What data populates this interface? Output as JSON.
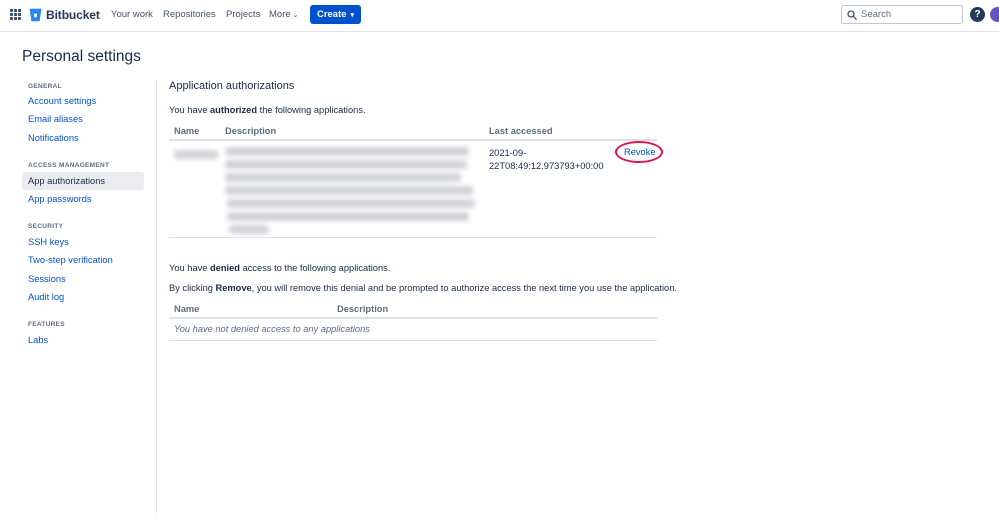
{
  "nav": {
    "product": "Bitbucket",
    "links": [
      "Your work",
      "Repositories",
      "Projects",
      "More"
    ],
    "create_label": "Create",
    "search_placeholder": "Search",
    "help_label": "?"
  },
  "page": {
    "title": "Personal settings"
  },
  "sidebar": {
    "sections": [
      {
        "heading": "GENERAL",
        "items": [
          "Account settings",
          "Email aliases",
          "Notifications"
        ]
      },
      {
        "heading": "ACCESS MANAGEMENT",
        "items": [
          "App authorizations",
          "App passwords"
        ]
      },
      {
        "heading": "SECURITY",
        "items": [
          "SSH keys",
          "Two-step verification",
          "Sessions",
          "Audit log"
        ]
      },
      {
        "heading": "FEATURES",
        "items": [
          "Labs"
        ]
      }
    ],
    "active_item": "App authorizations"
  },
  "authorized": {
    "heading": "Application authorizations",
    "intro_pre": "You have ",
    "intro_bold": "authorized",
    "intro_post": " the following applications.",
    "columns": [
      "Name",
      "Description",
      "Last accessed"
    ],
    "rows": [
      {
        "last_accessed_line1": "2021-09-",
        "last_accessed_line2": "22T08:49:12.973793+00:00",
        "action": "Revoke"
      }
    ]
  },
  "denied": {
    "intro_pre": "You have ",
    "intro_bold": "denied",
    "intro_post": " access to the following applications.",
    "note_pre": "By clicking ",
    "note_bold": "Remove",
    "note_post": ", you will remove this denial and be prompted to authorize access the next time you use the application.",
    "columns": [
      "Name",
      "Description"
    ],
    "empty_message": "You have not denied access to any applications"
  },
  "colors": {
    "brand": "#0052cc",
    "highlight_ring": "#e0115f"
  }
}
